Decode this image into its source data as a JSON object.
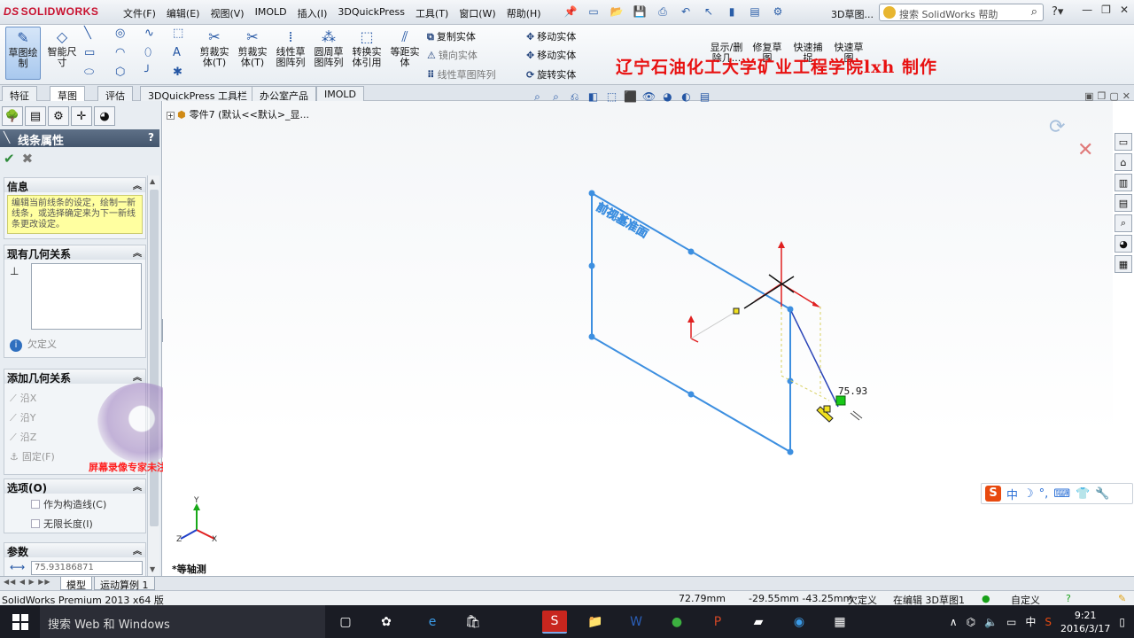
{
  "app": {
    "logo_prefix": "DS",
    "logo": "SOLIDWORKS",
    "product": "SolidWorks Premium 2013 x64 版"
  },
  "menu": [
    "文件(F)",
    "编辑(E)",
    "视图(V)",
    "IMOLD",
    "插入(I)",
    "3DQuickPress",
    "工具(T)",
    "窗口(W)",
    "帮助(H)"
  ],
  "title_sketch": "3D草图...",
  "search": {
    "placeholder": "搜索 SolidWorks 帮助"
  },
  "ribbon": {
    "sketch": "草图绘制",
    "smart_dim": "智能尺寸",
    "trim": "剪裁实体(T)",
    "convert": "转换实体引用",
    "offset": "等距实体",
    "linear_pattern": "线性草图阵列",
    "circular_pattern": "圆周草图阵列",
    "convert_entities": "转换实体引用",
    "offset_entities": "等距实体",
    "copy_entities": "复制实体",
    "mirror_entities": "镜向实体",
    "linear_sketch_pattern": "线性草图阵列",
    "move_entities": "移动实体",
    "move_entities2": "移动实体",
    "rotate_entities": "旋转实体",
    "show_delete": "显示/删除几...",
    "repair": "修复草图",
    "quick_snap": "快速捕捉",
    "rapid_sketch": "快速草图"
  },
  "banner": "辽宁石油化工大学矿业工程学院lxh 制作",
  "cmd_tabs": [
    "特征",
    "草图",
    "评估",
    "3DQuickPress 工具栏",
    "办公室产品",
    "IMOLD"
  ],
  "property_manager": {
    "title": "线条属性",
    "help": "?",
    "info_header": "信息",
    "info_text": "编辑当前线条的设定，绘制一新线条，或选择确定来为下一新线条更改设定。",
    "existing_rel_header": "现有几何关系",
    "status": "欠定义",
    "add_rel_header": "添加几何关系",
    "rel_x": "沿X",
    "rel_y": "沿Y",
    "rel_z": "沿Z",
    "rel_fix": "固定(F)",
    "options_header": "选项(O)",
    "opt_construction": "作为构造线(C)",
    "opt_infinite": "无限长度(I)",
    "params_header": "参数",
    "length_value": "75.93186871"
  },
  "watermark_ad": "屏幕录像专家未注册 tlxsoft.com",
  "graphics": {
    "tree_part": "零件7",
    "tree_config": "(默认<<默认>_显...",
    "plane_label": "前视基准面",
    "dimension": "75.93",
    "view_name": "*等轴测"
  },
  "model_tabs": [
    "模型",
    "运动算例 1"
  ],
  "status": {
    "x": "72.79mm",
    "yz": "-29.55mm -43.25mm",
    "defined": "欠定义",
    "editing": "在编辑 3D草图1",
    "custom": "自定义"
  },
  "taskbar": {
    "search": "搜索 Web 和 Windows",
    "lang": "中",
    "time": "9:21",
    "date": "2016/3/17"
  },
  "colors": {
    "sketch_blue": "#3d8fe0",
    "banner_red": "#e81010",
    "pm_header": "#4f6178"
  }
}
